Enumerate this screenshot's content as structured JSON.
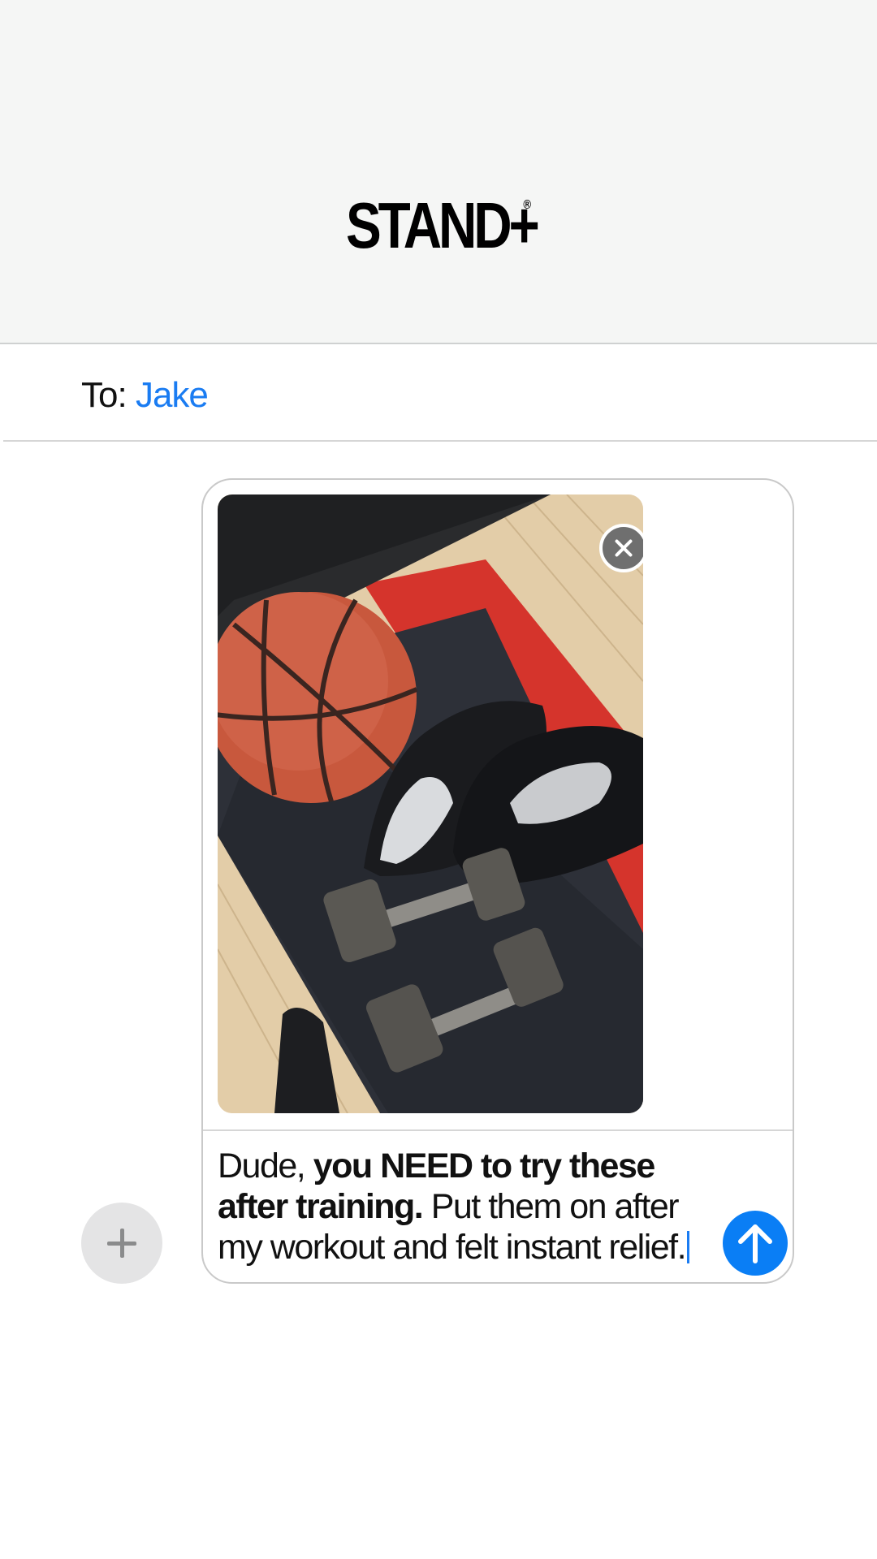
{
  "header": {
    "logo_text": "STAND+",
    "logo_mark": "®"
  },
  "recipient": {
    "label": "To:",
    "name": "Jake"
  },
  "composer": {
    "attachment_alt": "Basketball, foam roller, black shoes and dumbbells on a mat",
    "message_plain_1": "Dude, ",
    "message_bold": "you NEED to try these after training.",
    "message_plain_2": " Put them on after my workout and felt instant relief."
  },
  "icons": {
    "add": "plus-icon",
    "remove": "close-icon",
    "send": "arrow-up-icon"
  },
  "colors": {
    "accent_blue": "#1a7cf2",
    "send_blue": "#0a7ef5",
    "header_bg": "#f5f6f5"
  }
}
